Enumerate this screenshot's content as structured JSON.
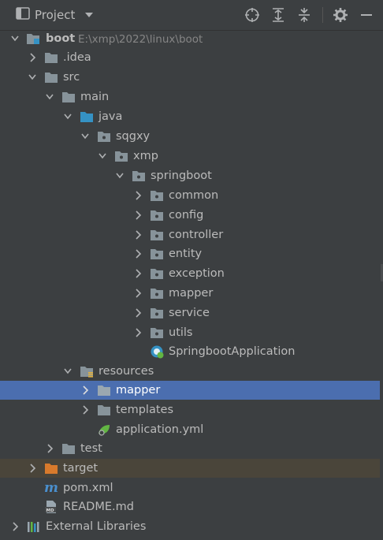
{
  "window": {
    "title": "Project"
  },
  "toolbar": {
    "dropdown_icon": "chevron-down-icon",
    "buttons": [
      "locate-icon",
      "expand-all-icon",
      "collapse-all-icon",
      "gear-icon",
      "minimize-icon"
    ]
  },
  "tree": {
    "root": {
      "label": "boot",
      "path": "E:\\xmp\\2022\\linux\\boot"
    },
    "idea": {
      "label": ".idea"
    },
    "src": {
      "label": "src"
    },
    "main": {
      "label": "main"
    },
    "java": {
      "label": "java"
    },
    "sqgxy": {
      "label": "sqgxy"
    },
    "xmp": {
      "label": "xmp"
    },
    "springboot": {
      "label": "springboot"
    },
    "common": {
      "label": "common"
    },
    "config": {
      "label": "config"
    },
    "controller": {
      "label": "controller"
    },
    "entity": {
      "label": "entity"
    },
    "exception": {
      "label": "exception"
    },
    "mapper_pkg": {
      "label": "mapper"
    },
    "service": {
      "label": "service"
    },
    "utils": {
      "label": "utils"
    },
    "app_class": {
      "label": "SpringbootApplication"
    },
    "resources": {
      "label": "resources"
    },
    "mapper_res": {
      "label": "mapper"
    },
    "templates": {
      "label": "templates"
    },
    "app_yml": {
      "label": "application.yml"
    },
    "test": {
      "label": "test"
    },
    "target": {
      "label": "target"
    },
    "pom": {
      "label": "pom.xml"
    },
    "readme": {
      "label": "README.md"
    },
    "ext_libs": {
      "label": "External Libraries"
    }
  },
  "colors": {
    "background": "#3c3f41",
    "selection": "#4b6eaf",
    "excluded_highlight": "#4a453a",
    "folder": "#87939a",
    "source_folder": "#3592c4",
    "excluded_folder": "#d87a2c"
  }
}
